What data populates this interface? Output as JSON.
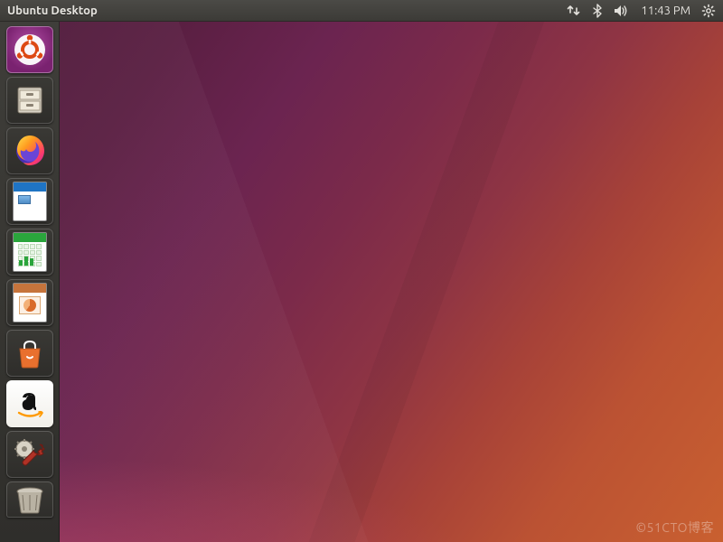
{
  "menubar": {
    "title": "Ubuntu Desktop",
    "clock": "11:43 PM",
    "indicators": {
      "network": "network-updown-icon",
      "bluetooth": "bluetooth-icon",
      "sound": "volume-high-icon",
      "session": "gear-icon"
    }
  },
  "launcher": {
    "items": [
      {
        "name": "dash",
        "label": "Search your computer"
      },
      {
        "name": "files",
        "label": "Files"
      },
      {
        "name": "firefox",
        "label": "Firefox Web Browser"
      },
      {
        "name": "libreoffice-writer",
        "label": "LibreOffice Writer"
      },
      {
        "name": "libreoffice-calc",
        "label": "LibreOffice Calc"
      },
      {
        "name": "libreoffice-impress",
        "label": "LibreOffice Impress"
      },
      {
        "name": "ubuntu-software",
        "label": "Ubuntu Software"
      },
      {
        "name": "amazon",
        "label": "Amazon"
      },
      {
        "name": "system-settings",
        "label": "System Settings"
      },
      {
        "name": "trash",
        "label": "Trash"
      }
    ]
  },
  "watermark": "©51CTO博客"
}
